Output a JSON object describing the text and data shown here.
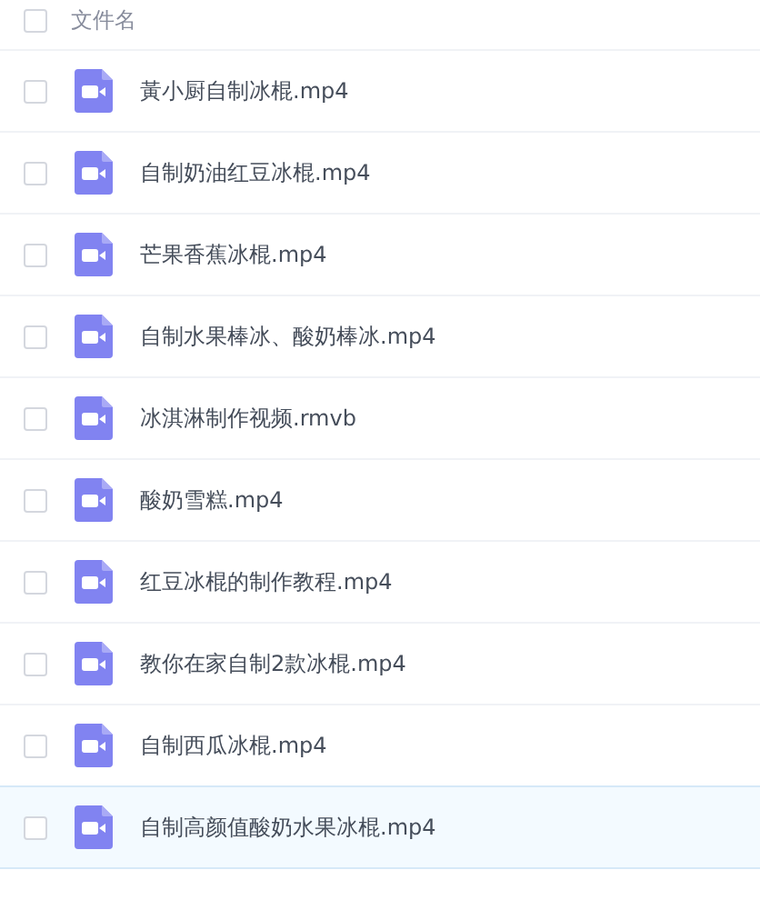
{
  "header": {
    "checked": false,
    "label": "文件名"
  },
  "files": [
    {
      "name": "黃小厨自制冰棍.mp4",
      "checked": false,
      "hovered": false
    },
    {
      "name": "自制奶油红豆冰棍.mp4",
      "checked": false,
      "hovered": false
    },
    {
      "name": "芒果香蕉冰棍.mp4",
      "checked": false,
      "hovered": false
    },
    {
      "name": "自制水果棒冰、酸奶棒冰.mp4",
      "checked": false,
      "hovered": false
    },
    {
      "name": "冰淇淋制作视频.rmvb",
      "checked": false,
      "hovered": false
    },
    {
      "name": "酸奶雪糕.mp4",
      "checked": false,
      "hovered": false
    },
    {
      "name": "红豆冰棍的制作教程.mp4",
      "checked": false,
      "hovered": false
    },
    {
      "name": "教你在家自制2款冰棍.mp4",
      "checked": false,
      "hovered": false
    },
    {
      "name": "自制西瓜冰棍.mp4",
      "checked": false,
      "hovered": false
    },
    {
      "name": "自制高颜值酸奶水果冰棍.mp4",
      "checked": false,
      "hovered": true
    }
  ]
}
